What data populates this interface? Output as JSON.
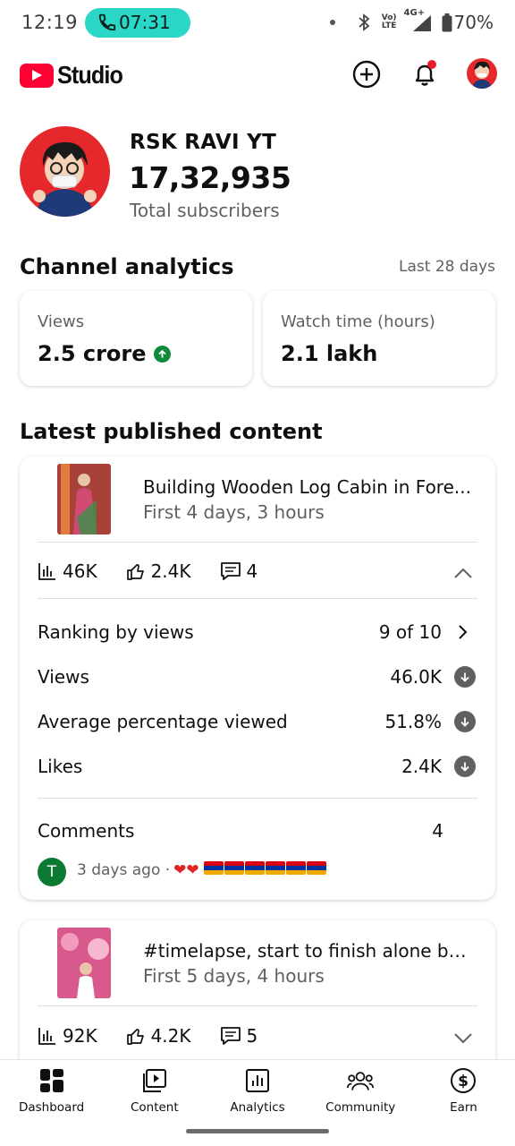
{
  "status_bar": {
    "time": "12:19",
    "call_timer": "07:31",
    "network_top": "Vo)",
    "network_bottom": "LTE",
    "signal_label": "4G+",
    "battery": "70%"
  },
  "app": {
    "logo_text": "Studio",
    "brand_color": "#ff0033"
  },
  "channel": {
    "name": "RSK RAVI YT",
    "subscribers": "17,32,935",
    "subscribers_label": "Total subscribers"
  },
  "analytics": {
    "title": "Channel analytics",
    "period": "Last 28 days",
    "metrics": [
      {
        "label": "Views",
        "value": "2.5 crore",
        "trend": "up"
      },
      {
        "label": "Watch time (hours)",
        "value": "2.1 lakh"
      }
    ]
  },
  "latest": {
    "title": "Latest published content",
    "items": [
      {
        "title": "Building Wooden Log Cabin in Fore...",
        "subtitle": "First 4 days, 3 hours",
        "views": "46K",
        "likes": "2.4K",
        "comments": "4",
        "expanded": true,
        "details": [
          {
            "label": "Ranking by views",
            "value": "9 of 10",
            "icon": "chevron-right-icon"
          },
          {
            "label": "Views",
            "value": "46.0K",
            "icon": "arrow-down-icon"
          },
          {
            "label": "Average percentage viewed",
            "value": "51.8%",
            "icon": "arrow-down-icon"
          },
          {
            "label": "Likes",
            "value": "2.4K",
            "icon": "arrow-down-icon"
          }
        ],
        "comments_label": "Comments",
        "comments_count": "4",
        "latest_comment": {
          "avatar_letter": "T",
          "meta": "3 days ago ·"
        }
      },
      {
        "title": "#timelapse, start to finish alone bui...",
        "subtitle": "First 5 days, 4 hours",
        "views": "92K",
        "likes": "4.2K",
        "comments": "5",
        "expanded": false
      }
    ]
  },
  "nav": [
    {
      "label": "Dashboard",
      "icon": "dashboard-icon"
    },
    {
      "label": "Content",
      "icon": "content-icon"
    },
    {
      "label": "Analytics",
      "icon": "analytics-icon"
    },
    {
      "label": "Community",
      "icon": "community-icon"
    },
    {
      "label": "Earn",
      "icon": "earn-icon"
    }
  ]
}
